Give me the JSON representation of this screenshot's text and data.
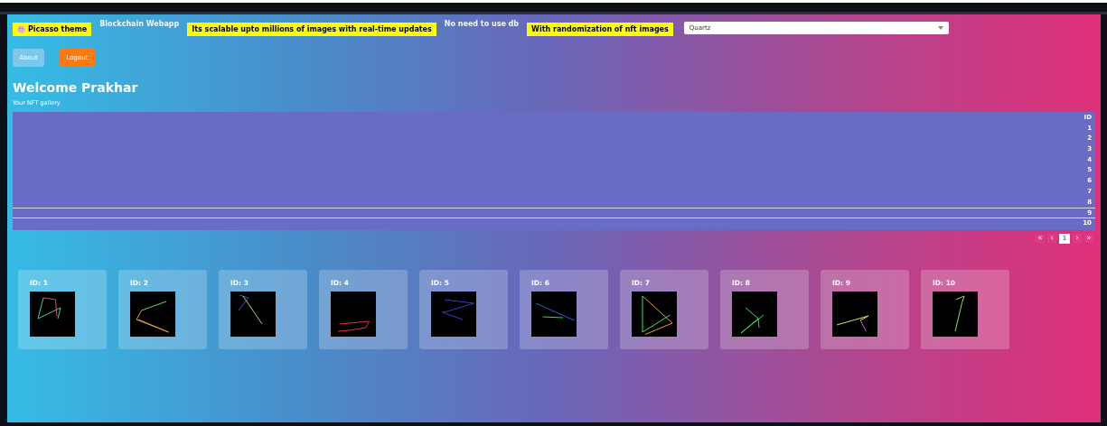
{
  "header": {
    "items": [
      {
        "kind": "badge",
        "label": "Picasso theme",
        "icon": true
      },
      {
        "kind": "plain",
        "label": "Blockchain Webapp"
      },
      {
        "kind": "badge",
        "label": "Its scalable upto millions of images with real-time updates",
        "icon": false
      },
      {
        "kind": "plain",
        "label": "No need to use db"
      },
      {
        "kind": "badge",
        "label": "With randomization of nft images",
        "icon": false
      }
    ],
    "theme_select": {
      "value": "Quartz"
    }
  },
  "buttons": [
    {
      "label": "About",
      "kind": "secondary"
    },
    {
      "label": "Logout",
      "kind": "primary"
    }
  ],
  "welcome": "Welcome Prakhar",
  "subtitle": "Your NFT gallery",
  "table": {
    "columns": [
      "ID"
    ],
    "rows": [
      {
        "id": "1",
        "selected": false
      },
      {
        "id": "2",
        "selected": false
      },
      {
        "id": "3",
        "selected": false
      },
      {
        "id": "4",
        "selected": false
      },
      {
        "id": "5",
        "selected": false
      },
      {
        "id": "6",
        "selected": false
      },
      {
        "id": "7",
        "selected": false
      },
      {
        "id": "8",
        "selected": false
      },
      {
        "id": "9",
        "selected": true
      },
      {
        "id": "10",
        "selected": false
      }
    ]
  },
  "pagination": {
    "first": "«",
    "prev": "‹",
    "page": "1",
    "next": "›",
    "last": "»"
  },
  "cards": [
    {
      "label": "ID: 1"
    },
    {
      "label": "ID: 2"
    },
    {
      "label": "ID: 3"
    },
    {
      "label": "ID: 4"
    },
    {
      "label": "ID: 5"
    },
    {
      "label": "ID: 6"
    },
    {
      "label": "ID: 7"
    },
    {
      "label": "ID: 8"
    },
    {
      "label": "ID: 9"
    },
    {
      "label": "ID: 10"
    }
  ]
}
